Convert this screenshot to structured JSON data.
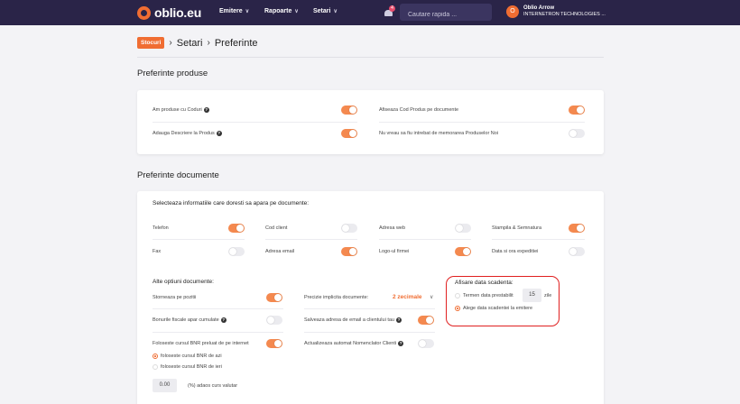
{
  "nav": {
    "logo": "oblio.eu",
    "items": [
      "Emitere",
      "Rapoarte",
      "Setari"
    ],
    "notification_count": "4",
    "search_placeholder": "Cautare rapida ...",
    "user_initial": "O",
    "user_name": "Oblio Arrow",
    "user_company": "INTERNETRON TECHNOLOGIES ..."
  },
  "breadcrumb": {
    "badge": "Stocuri",
    "items": [
      "Setari",
      "Preferinte"
    ]
  },
  "produse": {
    "title": "Preferinte produse",
    "rows": [
      {
        "label": "Am produse cu Coduri",
        "help": true,
        "on": true
      },
      {
        "label": "Afiseaza Cod Produs pe documente",
        "help": false,
        "on": true
      },
      {
        "label": "Adauga Descriere la Produs",
        "help": true,
        "on": true
      },
      {
        "label": "Nu vreau sa fiu intrebat de memorarea Produselor Noi",
        "help": false,
        "on": false
      }
    ]
  },
  "documente": {
    "title": "Preferinte documente",
    "subtitle": "Selecteaza informatiile care doresti sa apara pe documente:",
    "info_fields": [
      {
        "label": "Telefon",
        "on": true
      },
      {
        "label": "Cod client",
        "on": false
      },
      {
        "label": "Adresa web",
        "on": false
      },
      {
        "label": "Stampila & Semnatura",
        "on": true
      },
      {
        "label": "Fax",
        "on": false
      },
      {
        "label": "Adresa email",
        "on": true
      },
      {
        "label": "Logo-ul firmei",
        "on": true
      },
      {
        "label": "Data si ora expeditiei",
        "on": false
      }
    ],
    "other_title": "Alte optiuni documente:",
    "left_options": [
      {
        "label": "Storneaza pe pozitii",
        "help": false,
        "on": true
      },
      {
        "label": "Bonurile fiscale apar cumulate",
        "help": true,
        "on": false
      },
      {
        "label": "Foloseste cursul BNR preluat de pe internet",
        "help": false,
        "on": true
      }
    ],
    "bnr_radios": [
      {
        "label": "foloseste cursul BNR de azi",
        "selected": true
      },
      {
        "label": "foloseste cursul BNR de ieri",
        "selected": false
      }
    ],
    "curs_value": "0.00",
    "curs_label": "(%) adaos curs valutar",
    "precizie_label": "Precizie implicita documente:",
    "precizie_value": "2 zecimale",
    "mid_options": [
      {
        "label": "Salveaza adresa de email a clientului tau",
        "help": true,
        "on": true
      },
      {
        "label": "Actualizeaza automat Nomenclator Clienti",
        "help": true,
        "on": false
      }
    ],
    "scadenta": {
      "title": "Afisare data scadenta:",
      "option1": "Termen data prestabilit",
      "days_value": "15",
      "days_unit": "zile",
      "option2": "Alege data scadentei la emitere",
      "selected": 2
    }
  },
  "colors": {
    "nav_bg": "#2a2448",
    "accent": "#f06d32",
    "toggle_on": "#f4894f",
    "highlight_box": "#e02020"
  }
}
